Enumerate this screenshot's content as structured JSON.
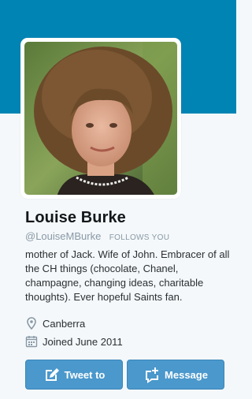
{
  "profile": {
    "name": "Louise Burke",
    "handle": "@LouiseMBurke",
    "follows_you": "FOLLOWS YOU",
    "bio": "mother of Jack. Wife of John. Embracer of all the CH things (chocolate, Chanel, champagne, changing ideas, charitable thoughts). Ever hopeful Saints fan.",
    "location": "Canberra",
    "joined": "Joined June 2011"
  },
  "actions": {
    "tweet_label": "Tweet to",
    "message_label": "Message"
  },
  "icons": {
    "location": "map-pin-icon",
    "joined": "calendar-icon",
    "tweet": "compose-icon",
    "message": "new-message-icon"
  },
  "colors": {
    "banner": "#0084b4",
    "button": "#4a98cc",
    "name": "#14171a",
    "muted": "#8899a6",
    "background": "#f5f8fa"
  }
}
